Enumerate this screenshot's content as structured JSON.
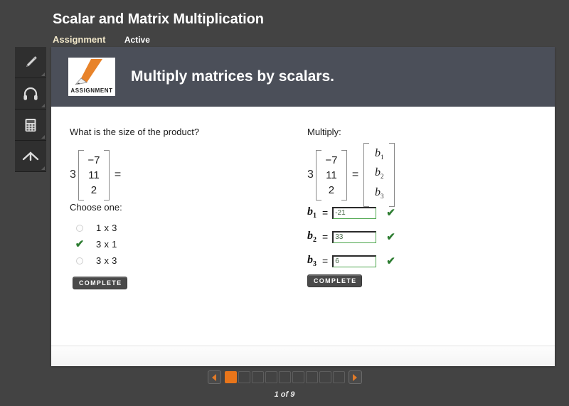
{
  "header": {
    "title": "Scalar and Matrix Multiplication",
    "assignment_label": "Assignment",
    "status_label": "Active"
  },
  "tool_rail": {
    "items": [
      {
        "icon": "pencil-icon",
        "name": "highlighter-tool"
      },
      {
        "icon": "headphones-icon",
        "name": "audio-tool"
      },
      {
        "icon": "calculator-icon",
        "name": "calculator-tool"
      },
      {
        "icon": "up-arrow-icon",
        "name": "collapse-tool"
      }
    ]
  },
  "content": {
    "icon_caption": "ASSIGNMENT",
    "heading": "Multiply matrices by scalars."
  },
  "left_problem": {
    "prompt": "What is the size of the product?",
    "scalar": "3",
    "matrix": [
      "−7",
      "11",
      "2"
    ],
    "equals": "=",
    "choose_label": "Choose one:",
    "choices": [
      {
        "label": "1 x 3",
        "selected": false
      },
      {
        "label": "3 x 1",
        "selected": true
      },
      {
        "label": "3 x 3",
        "selected": false
      }
    ],
    "complete_label": "COMPLETE"
  },
  "right_problem": {
    "prompt": "Multiply:",
    "scalar": "3",
    "matrix": [
      "−7",
      "11",
      "2"
    ],
    "equals": "=",
    "result_matrix": [
      "b",
      "b",
      "b"
    ],
    "result_subscripts": [
      "1",
      "2",
      "3"
    ],
    "answers": [
      {
        "var": "b",
        "sub": "1",
        "eq": "=",
        "value": "-21",
        "placeholder": "",
        "correct": true
      },
      {
        "var": "b",
        "sub": "2",
        "eq": "=",
        "value": "33",
        "placeholder": "",
        "correct": true
      },
      {
        "var": "b",
        "sub": "3",
        "eq": "=",
        "value": "6",
        "placeholder": "",
        "correct": true
      }
    ],
    "complete_label": "COMPLETE"
  },
  "glyphs": {
    "check": "✔",
    "prev": "prev-arrow-icon",
    "next": "next-arrow-icon"
  },
  "pagination": {
    "total_pages": 9,
    "current_page": 1,
    "counter_text": "1 of 9"
  },
  "colors": {
    "background": "#434343",
    "panel_header": "#4b4f59",
    "accent_orange": "#e8751a",
    "correct_green": "#2e7d32",
    "assignment_tan": "#f0e6c8"
  }
}
